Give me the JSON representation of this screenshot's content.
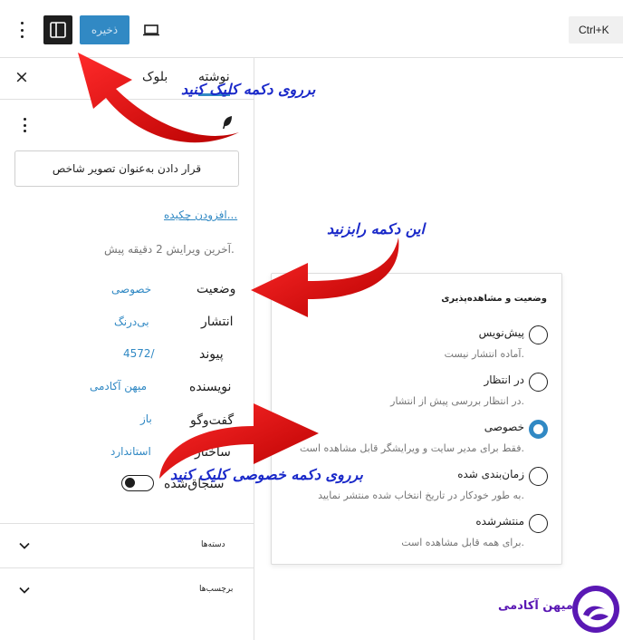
{
  "toolbar": {
    "save_label": "ذخیره",
    "shortcut_label": "Ctrl+K",
    "icons": [
      "more-vertical-icon",
      "sidebar-toggle-icon",
      "desktop-preview-icon"
    ]
  },
  "sidebar": {
    "tabs": [
      {
        "label": "بلوک"
      },
      {
        "label": "نوشته"
      }
    ],
    "featured_image_button": "قرار دادن به‌عنوان تصویر شاخص",
    "excerpt_link": "افزودن چکیده...",
    "last_edited": "آخرین ویرایش 2 دقیقه پیش.",
    "rows": {
      "status": {
        "label": "وضعیت",
        "value": "خصوصی"
      },
      "publish": {
        "label": "انتشار",
        "value": "بی‌درنگ"
      },
      "link": {
        "label": "پیوند",
        "value": "4572/"
      },
      "author": {
        "label": "نویسنده",
        "value": "میهن آکادمی"
      },
      "discussion": {
        "label": "گفت‌وگو",
        "value": "باز"
      },
      "template": {
        "label": "ساختار",
        "value": "استاندارد"
      },
      "sticky": {
        "label": "سنجاق‌شده",
        "checked": true
      }
    },
    "panels": [
      {
        "title": "دسته‌ها"
      },
      {
        "title": "برچسب‌ها"
      }
    ]
  },
  "popover": {
    "title": "وضعیت و مشاهده‌پذیری",
    "options": [
      {
        "label": "پیش‌نویس",
        "desc": "آماده انتشار نیست.",
        "selected": false
      },
      {
        "label": "در انتظار",
        "desc": "در انتظار بررسی پیش از انتشار.",
        "selected": false
      },
      {
        "label": "خصوصی",
        "desc": "فقط برای مدیر سایت و ویرایشگر قابل مشاهده است.",
        "selected": true
      },
      {
        "label": "زمان‌بندی شده",
        "desc": "به طور خودکار در تاریخ انتخاب شده منتشر نمایید.",
        "selected": false
      },
      {
        "label": "منتشرشده",
        "desc": "برای همه قابل مشاهده است.",
        "selected": false
      }
    ]
  },
  "annotations": {
    "click_button": "برروی دکمه کلیک کنید",
    "press_button": "این دکمه رابزنید",
    "click_private": "برروی دکمه خصوصی کلیک کنید"
  },
  "brand": {
    "name": "میهن آکادمی"
  },
  "colors": {
    "accent": "#3189c4",
    "arrow": "#e30a0a",
    "annotation_text": "#1a29c9",
    "brand": "#5a18b4"
  }
}
